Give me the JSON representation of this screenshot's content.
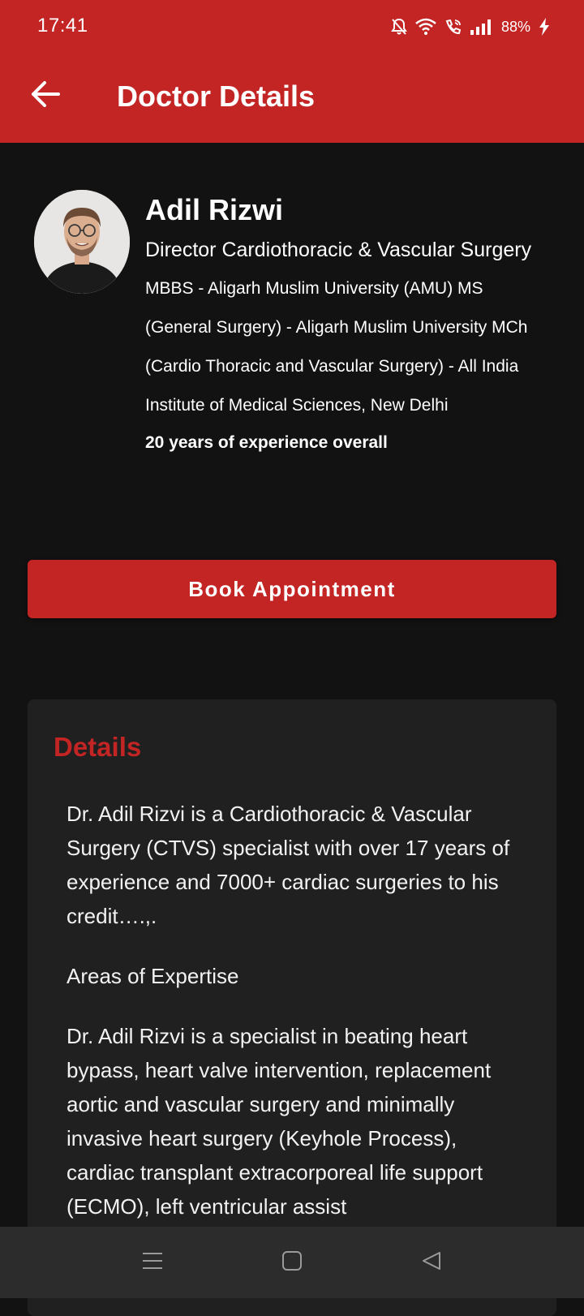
{
  "status_bar": {
    "time": "17:41",
    "battery": "88%",
    "icons": [
      "bell-off-icon",
      "wifi-icon",
      "wifi-calling-icon",
      "signal-icon",
      "charging-icon"
    ]
  },
  "app_bar": {
    "title": "Doctor Details",
    "back_icon": "arrow-left-icon"
  },
  "doctor": {
    "name": "Adil Rizwi",
    "title": "Director Cardiothoracic & Vascular Surgery",
    "qualifications": "MBBS - Aligarh Muslim University (AMU) MS (General Surgery) - Aligarh Muslim University MCh (Cardio Thoracic and Vascular Surgery) - All India Institute of Medical Sciences, New Delhi",
    "experience": "20 years of experience overall"
  },
  "actions": {
    "book_label": "Book Appointment"
  },
  "details": {
    "heading": "Details",
    "paragraphs": [
      "Dr. Adil Rizvi is a Cardiothoracic & Vascular Surgery (CTVS) specialist with over 17 years of experience and 7000+ cardiac surgeries to his credit….,.",
      "Areas of Expertise",
      "Dr. Adil Rizvi is a specialist in beating heart bypass, heart valve intervention, replacement aortic and vascular surgery and minimally invasive heart surgery (Keyhole Process), cardiac transplant extracorporeal life support (ECMO), left ventricular assist"
    ]
  },
  "nav_bar": {
    "items": [
      "menu-icon",
      "home-square-icon",
      "back-triangle-icon"
    ]
  },
  "colors": {
    "accent": "#c32424",
    "background": "#121212",
    "card": "#202020",
    "nav": "#2c2c2c"
  }
}
